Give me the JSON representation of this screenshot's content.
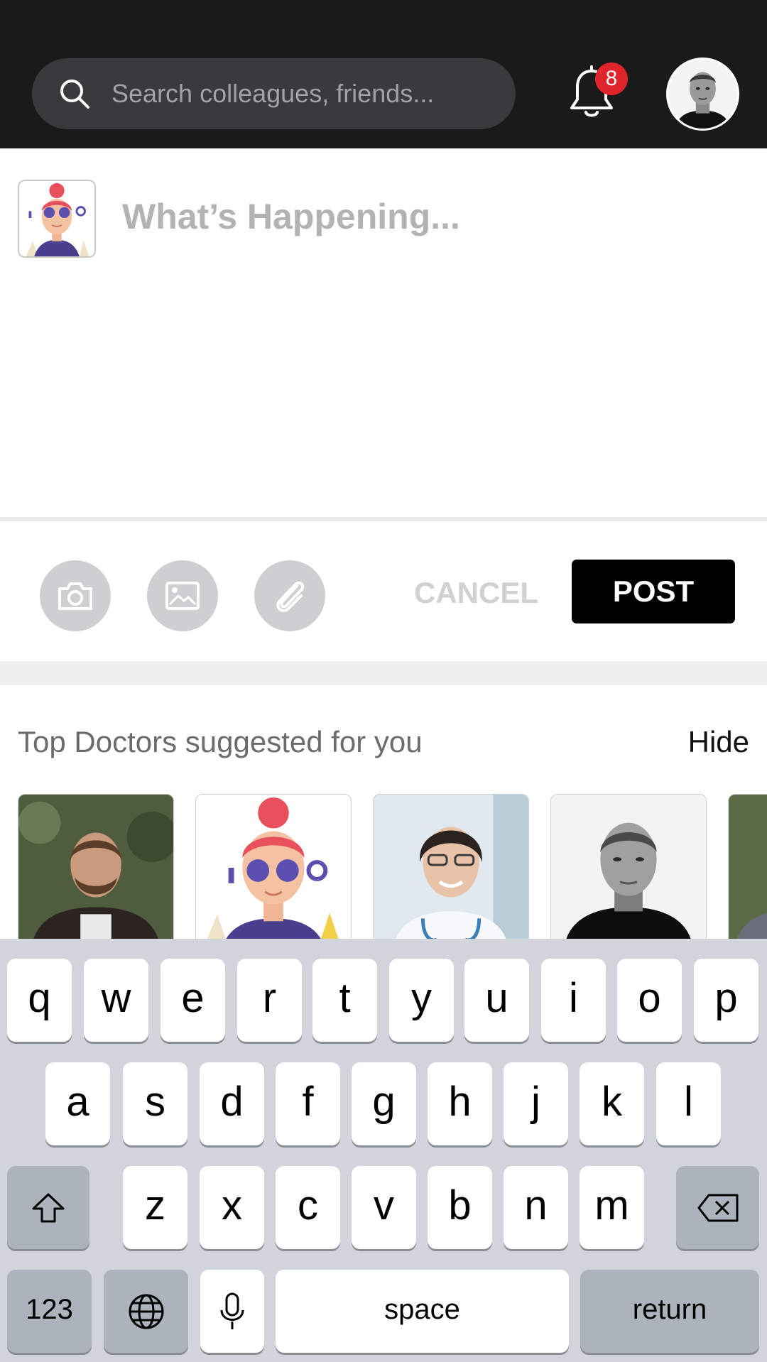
{
  "header": {
    "search_placeholder": "Search colleagues, friends...",
    "notification_count": "8"
  },
  "composer": {
    "placeholder": "What’s Happening...",
    "cancel_label": "CANCEL",
    "post_label": "POST"
  },
  "suggestions": {
    "title": "Top Doctors suggested for you",
    "hide_label": "Hide"
  },
  "keyboard": {
    "row1": [
      "q",
      "w",
      "e",
      "r",
      "t",
      "y",
      "u",
      "i",
      "o",
      "p"
    ],
    "row2": [
      "a",
      "s",
      "d",
      "f",
      "g",
      "h",
      "j",
      "k",
      "l"
    ],
    "row3": [
      "z",
      "x",
      "c",
      "v",
      "b",
      "n",
      "m"
    ],
    "numbers_label": "123",
    "space_label": "space",
    "return_label": "return"
  },
  "colors": {
    "header_bg": "#1a1a1b",
    "badge": "#e0242b",
    "post_button": "#000000",
    "keyboard_bg": "#d1d4db"
  }
}
